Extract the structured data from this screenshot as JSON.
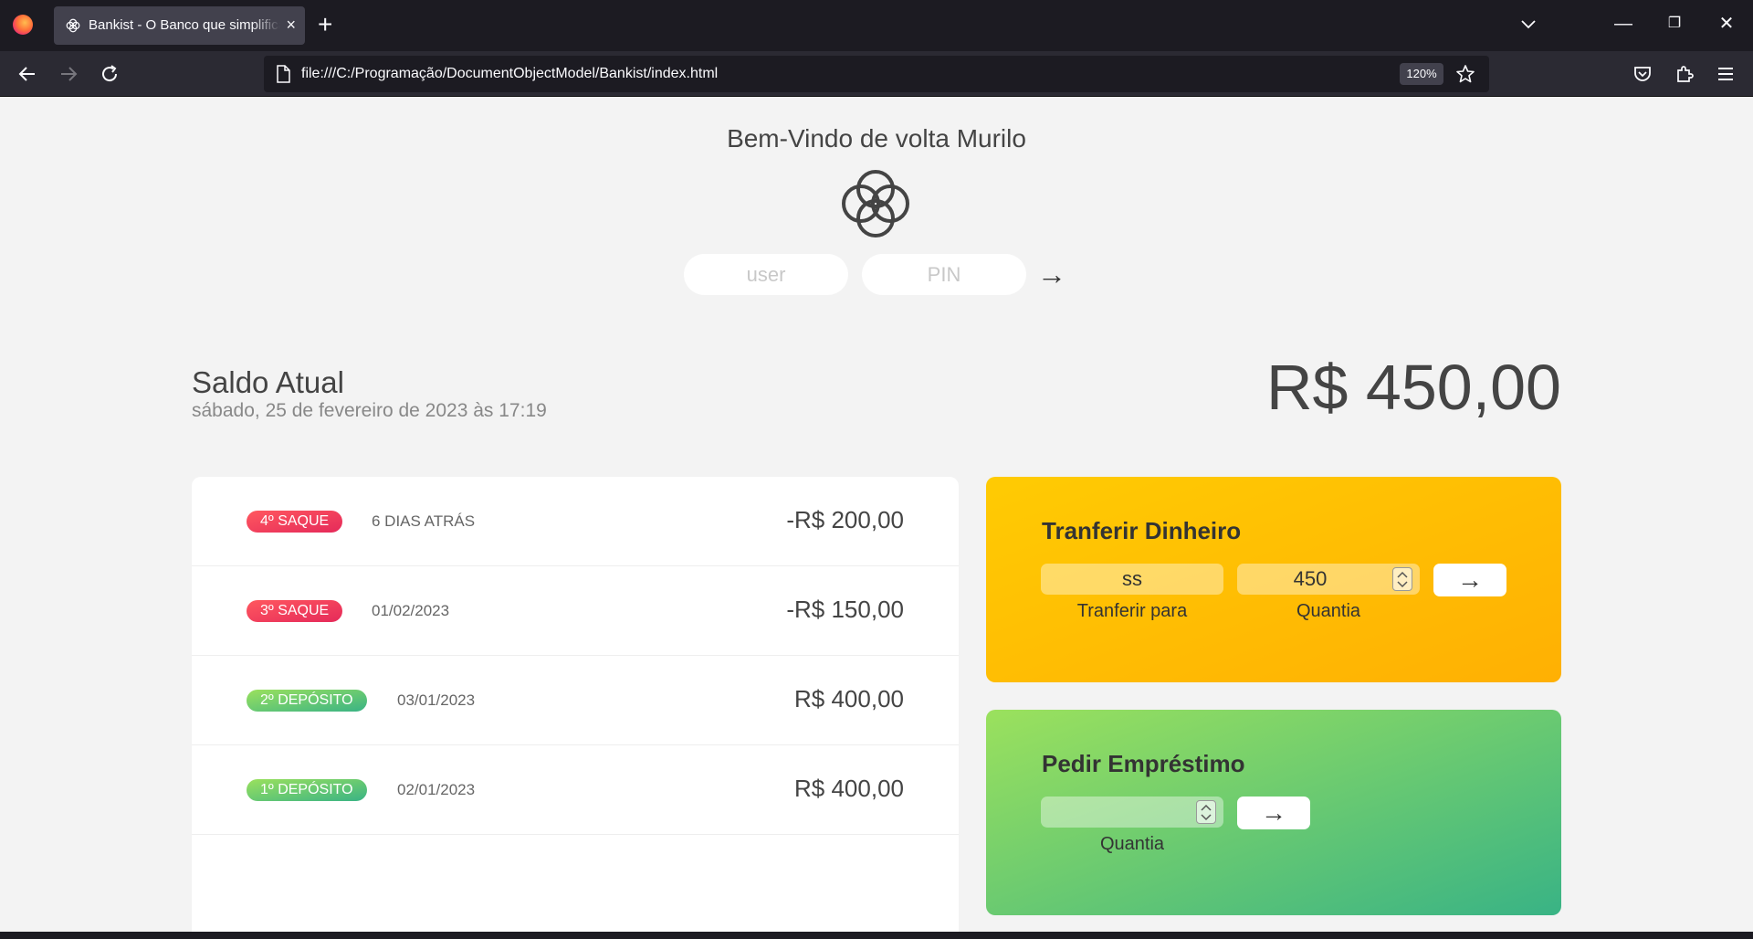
{
  "browser": {
    "tab_title": "Bankist - O Banco que simplifica",
    "url": "file:///C:/Programação/DocumentObjectModel/Bankist/index.html",
    "zoom": "120%",
    "tab_close": "×",
    "new_tab": "+",
    "minimize": "—",
    "restore": "❐",
    "close": "✕"
  },
  "header": {
    "welcome": "Bem-Vindo de volta Murilo",
    "user_placeholder": "user",
    "pin_placeholder": "PIN",
    "login_button": "→"
  },
  "balance": {
    "label": "Saldo Atual",
    "date": "sábado, 25 de fevereiro de 2023 às 17:19",
    "value": "R$ 450,00"
  },
  "movements": [
    {
      "type": "4º Saque",
      "kind": "withdrawal",
      "date": "6 dias atrás",
      "value": "-R$ 200,00"
    },
    {
      "type": "3º Saque",
      "kind": "withdrawal",
      "date": "01/02/2023",
      "value": "-R$ 150,00"
    },
    {
      "type": "2º Depósito",
      "kind": "deposit",
      "date": "03/01/2023",
      "value": "R$ 400,00"
    },
    {
      "type": "1º Depósito",
      "kind": "deposit",
      "date": "02/01/2023",
      "value": "R$ 400,00"
    }
  ],
  "transfer": {
    "title": "Tranferir Dinheiro",
    "to_value": "ss",
    "amount_value": "450",
    "to_label": "Tranferir para",
    "amount_label": "Quantia",
    "button": "→"
  },
  "loan": {
    "title": "Pedir Empréstimo",
    "amount_value": "",
    "amount_label": "Quantia",
    "button": "→"
  },
  "colors": {
    "withdrawal": "#e52a5a",
    "deposit": "#39b385",
    "transfer_bg": "#ffb003",
    "loan_bg": "#9be15d"
  }
}
